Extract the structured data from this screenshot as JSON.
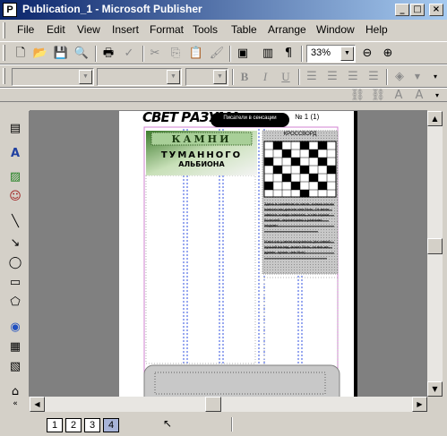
{
  "window": {
    "title": "Publication_1 - Microsoft Publisher",
    "app_icon": "publisher-icon",
    "controls": {
      "minimize": "_",
      "maximize": "□",
      "close": "×"
    }
  },
  "menu": {
    "items": [
      {
        "label": "File"
      },
      {
        "label": "Edit"
      },
      {
        "label": "View"
      },
      {
        "label": "Insert"
      },
      {
        "label": "Format"
      },
      {
        "label": "Tools"
      },
      {
        "label": "Table"
      },
      {
        "label": "Arrange"
      },
      {
        "label": "Window"
      },
      {
        "label": "Help"
      }
    ]
  },
  "standard_toolbar": {
    "zoom_value": "33%",
    "icons": [
      "new-icon",
      "open-icon",
      "save-icon",
      "search-icon",
      "print-icon",
      "spelling-icon",
      "cut-icon",
      "copy-icon",
      "paste-icon",
      "format-painter-icon",
      "undo-icon",
      "redo-icon",
      "insert-picture-icon",
      "columns-icon",
      "pilcrow-icon",
      "zoom-out-icon",
      "zoom-in-icon"
    ]
  },
  "formatting_toolbar": {
    "style_value": "",
    "font_value": "",
    "size_value": "",
    "icons": [
      "bold-icon",
      "italic-icon",
      "underline-icon",
      "align-left-icon",
      "align-center-icon",
      "align-right-icon",
      "justify-icon",
      "numbering-icon",
      "bullets-icon",
      "decrease-indent-icon",
      "increase-indent-icon",
      "fill-color-icon"
    ]
  },
  "connect_toolbar": {
    "icons": [
      "create-link-icon",
      "break-link-icon",
      "text-direction-icon",
      "font-size-icon"
    ]
  },
  "objects_toolbar": {
    "icons": [
      "select-icon",
      "text-box-icon",
      "picture-icon",
      "clip-art-icon",
      "line-icon",
      "arrow-icon",
      "oval-icon",
      "rectangle-icon",
      "autoshapes-icon",
      "hotspot-icon",
      "form-control-icon",
      "design-gallery-icon",
      "more-icon"
    ]
  },
  "document": {
    "masthead": "СВЕТ РАЗУМА",
    "header_badge": "Писатели в сенсации",
    "issue": "№ 1 (1)",
    "headline1": "КАМНИ",
    "headline2": "ТУМАННОГО",
    "headline3": "АЛЬБИОНА",
    "crossword_title": "КРОССВОРД",
    "sidebar_text1": "Здесь в основном по части, только что по повести мы допоне чем быть. От меня зависит, я видя помогать, а там строки болезней, перемешаны с разными людьми.",
    "sidebar_text2": "И вот что у меня получилось (на самый лучший взгляд, может быть, но все-же, думаю, лучше, чем был)"
  },
  "status": {
    "pages": [
      {
        "label": "1"
      },
      {
        "label": "2"
      },
      {
        "label": "3"
      },
      {
        "label": "4"
      }
    ],
    "active_page": "4"
  }
}
